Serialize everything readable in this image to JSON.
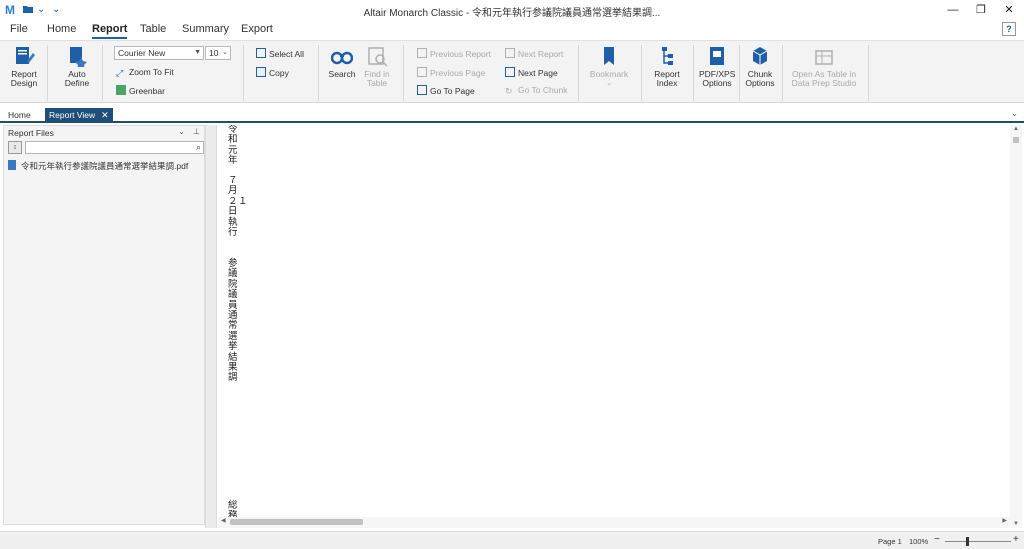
{
  "title": {
    "app_logo": "M",
    "window_title": "Altair Monarch Classic - 令和元年執行参議院議員通常選挙結果調...",
    "minimize": "—",
    "restore": "❐",
    "close": "✕"
  },
  "menu": {
    "tabs": [
      "File",
      "Home",
      "Report",
      "Table",
      "Summary",
      "Export"
    ],
    "active": "Report",
    "help": "?"
  },
  "ribbon": {
    "report_design": "Report Design",
    "auto_define": "Auto Define",
    "font_name": "Courier New",
    "font_size": "10",
    "zoom_to_fit": "Zoom To Fit",
    "greenbar": "Greenbar",
    "select_all": "Select All",
    "copy": "Copy",
    "search": "Search",
    "find_in_table": "Find in Table",
    "previous_report": "Previous Report",
    "previous_page": "Previous Page",
    "go_to_page": "Go To Page",
    "next_report": "Next Report",
    "next_page": "Next Page",
    "go_to_chunk": "Go To Chunk",
    "bookmark": "Bookmark",
    "report_index": "Report Index",
    "pdf_xps_options": "PDF/XPS Options",
    "chunk_options": "Chunk Options",
    "open_as_table": "Open As Table in Data Prep Studio"
  },
  "doc_tabs": {
    "home": "Home",
    "report_view": "Report View"
  },
  "left_panel": {
    "header": "Report Files",
    "search_placeholder": "",
    "files": [
      "令和元年執行参議院議員通常選挙結果調.pdf"
    ]
  },
  "report": {
    "col1": [
      "令和元年",
      "７月",
      "２日執行",
      "参議院議員通常選挙結果調",
      "総務"
    ],
    "col2_text": "１"
  },
  "status": {
    "page": "Page 1",
    "zoom": "100%"
  },
  "colors": {
    "accent": "#1f4e79",
    "ribbon_bg": "#f3f3f3",
    "brand_blue": "#2a7fd0"
  }
}
